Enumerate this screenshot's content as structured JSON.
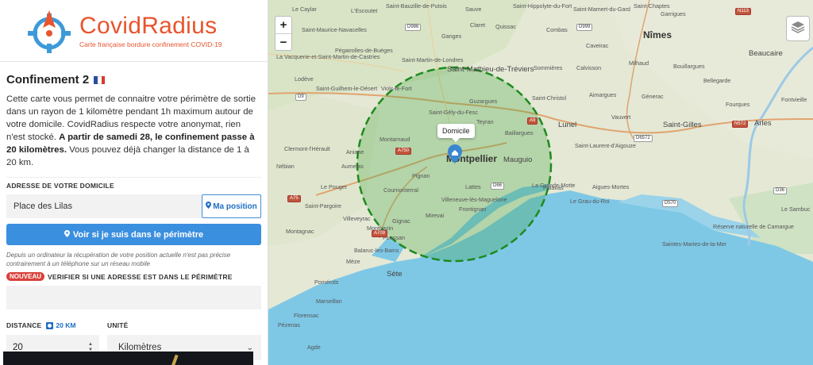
{
  "brand": {
    "name": "CovidRadius",
    "tagline": "Carte française bordure confinement COVID-19",
    "accent_color": "#e8542d",
    "logo_icon": "crosshair-pin-icon"
  },
  "panel": {
    "title": "Confinement 2",
    "title_flag": "france-flag-icon",
    "intro_part1": "Cette carte vous permet de connaitre votre périmètre de sortie dans un rayon de 1 kilomètre pendant 1h maximum autour de votre domicile. CovidRadius respecte votre anonymat, rien n'est stocké. ",
    "intro_bold": "A partir de samedi 28, le confinement passe à 20 kilomètres.",
    "intro_part2": " Vous pouvez déjà changer la distance de 1 à 20 km."
  },
  "address": {
    "label": "Adresse de votre domicile",
    "value": "Place des Lilas",
    "position_button": "Ma position",
    "position_icon": "map-marker-icon"
  },
  "check_button": {
    "label": "Voir si je suis dans le périmètre",
    "icon": "map-marker-icon",
    "color": "#3b8fdf"
  },
  "note": "Depuis un ordinateur la récupération de votre position actuelle n'est pas précise contrairement à un téléphone sur un réseau mobile",
  "verify": {
    "badge": "Nouveau",
    "label": "Verifier si une adresse est dans le périmètre",
    "value": ""
  },
  "distance": {
    "label": "Distance",
    "tag": "20 KM",
    "value": "20"
  },
  "unit": {
    "label": "Unité",
    "value": "Kilomètres"
  },
  "map": {
    "zoom_in": "+",
    "zoom_out": "−",
    "popup": "Domicile",
    "circle_color": "#1e8a1e",
    "water_color": "#7ec8e6",
    "places": [
      "Saint-Mathieu-de-Tréviers",
      "Montpellier",
      "Nîmes",
      "Lunel",
      "Arles",
      "Sète",
      "Agde",
      "Lodève",
      "Saint-Gilles",
      "Beaucaire",
      "Mauguio",
      "Palavas",
      "Vauvert",
      "Sommières",
      "Ganges",
      "Pézenas",
      "Mèze",
      "Frontignan",
      "Lattes",
      "Pignan",
      "Gignac",
      "Clermont-l'Hérault",
      "Aniane",
      "Montarnaud",
      "Cournonterral",
      "Villeneuve-lès-Maguelone",
      "Saint-Gély-du-Fesc",
      "Teyran",
      "Guzargues",
      "Viols-le-Fort",
      "Baillargues",
      "Saint-Christol",
      "Aimargues",
      "Aigues-Mortes",
      "La Grande-Motte",
      "Le Grau-du-Roi",
      "Saint-Laurent-d'Aigouze",
      "Génerac",
      "Bellegarde",
      "Fourques",
      "Fontvieille",
      "Le Sambuc",
      "Saintes-Maries-de-la-Mer",
      "Réserve naturelle de Camargue",
      "Saint-Martin-de-Londres",
      "Saint-Guilhem-le-Désert",
      "Balaruc-les-Bains",
      "Poussan",
      "Montagnac",
      "Villeveyrac",
      "Mirevai",
      "Saint-Pargoire",
      "Aumelas",
      "Montbazin",
      "Le Pouget",
      "Nébian",
      "Pomérols",
      "Marseillan",
      "Florensac",
      "Caveirac",
      "Milhaud",
      "Calvisson",
      "Combas",
      "Quissac",
      "Sauve",
      "Claret",
      "Pégairolles-de-Buèges",
      "Saint-Maurice-Navacelles",
      "La Vacquerie-et-Saint-Martin-de-Castries",
      "Le Caylar",
      "L'Escoutet",
      "Saint-Bauzille-de-Putois",
      "Saint-Hippolyte-du-Fort",
      "Saint-Mamert-du-Gard",
      "Saint-Chaptes",
      "Garrigues",
      "Bouillargues"
    ],
    "roads": [
      "D986",
      "D999",
      "A9",
      "D9",
      "A750",
      "A75",
      "D66",
      "D6572",
      "N572",
      "D570",
      "D36",
      "A709",
      "N113"
    ]
  }
}
